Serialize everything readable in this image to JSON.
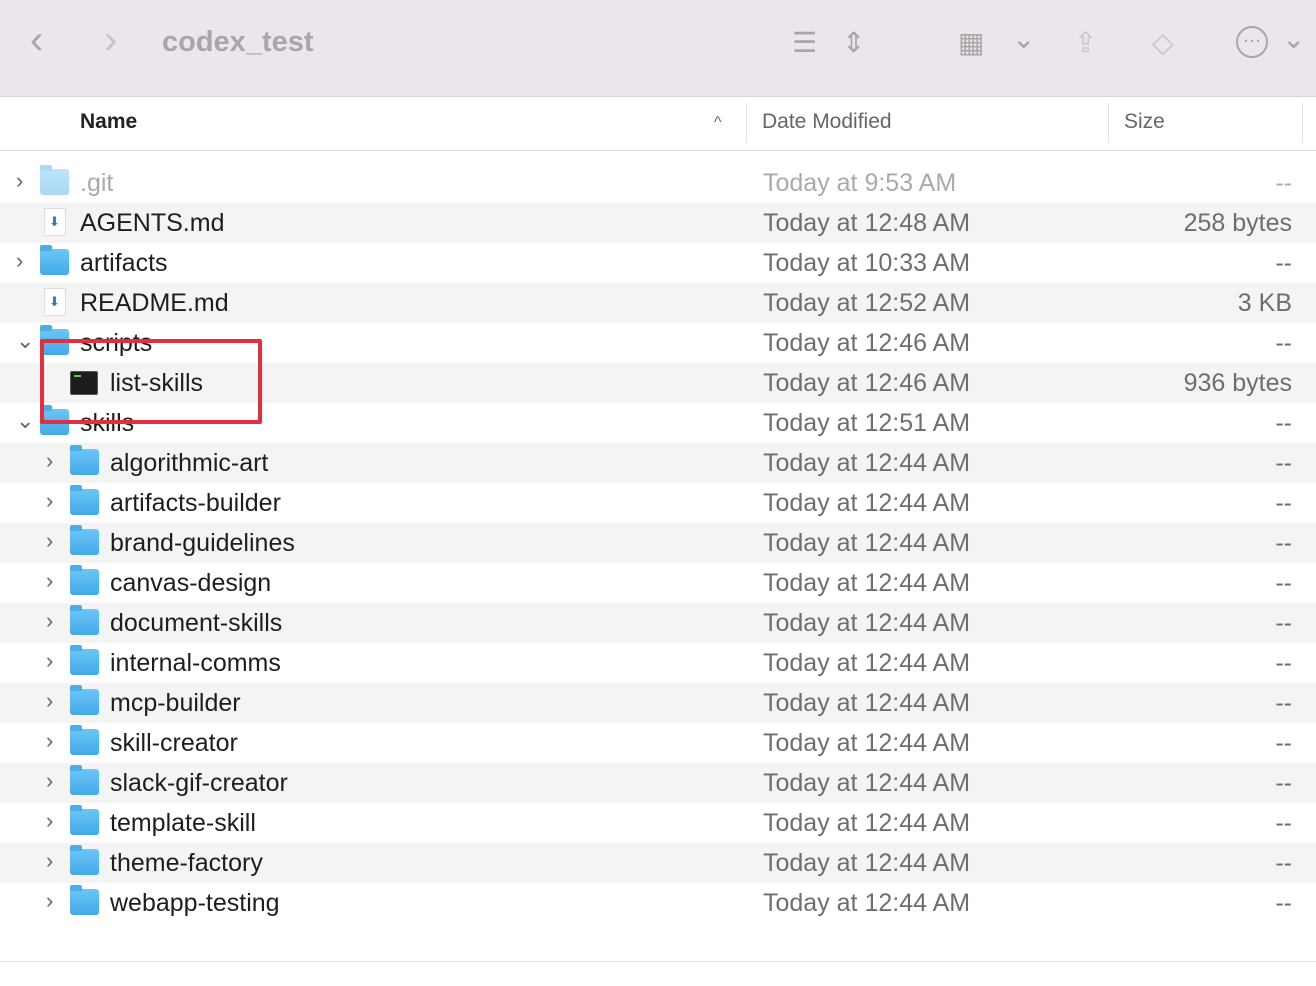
{
  "window": {
    "title": "codex_test"
  },
  "toolbar": {
    "back": "‹",
    "forward": "›",
    "view_list": "☰",
    "sort": "⇕",
    "group": "▦",
    "chev": "⌄",
    "share": "⇪",
    "tag": "◇",
    "more": "⋯"
  },
  "columns": {
    "name": "Name",
    "date": "Date Modified",
    "size": "Size",
    "sort_indicator": "^"
  },
  "rows": [
    {
      "name": ".git",
      "date": "Today at 9:53 AM",
      "size": "--",
      "type": "folder",
      "level": 0,
      "expand": "collapsed",
      "dim": true
    },
    {
      "name": "AGENTS.md",
      "date": "Today at 12:48 AM",
      "size": "258 bytes",
      "type": "doc",
      "level": 0,
      "expand": "none"
    },
    {
      "name": "artifacts",
      "date": "Today at 10:33 AM",
      "size": "--",
      "type": "folder",
      "level": 0,
      "expand": "collapsed"
    },
    {
      "name": "README.md",
      "date": "Today at 12:52 AM",
      "size": "3 KB",
      "type": "doc",
      "level": 0,
      "expand": "none"
    },
    {
      "name": "scripts",
      "date": "Today at 12:46 AM",
      "size": "--",
      "type": "folder",
      "level": 0,
      "expand": "expanded"
    },
    {
      "name": "list-skills",
      "date": "Today at 12:46 AM",
      "size": "936 bytes",
      "type": "term",
      "level": 1,
      "expand": "none"
    },
    {
      "name": "skills",
      "date": "Today at 12:51 AM",
      "size": "--",
      "type": "folder",
      "level": 0,
      "expand": "expanded"
    },
    {
      "name": "algorithmic-art",
      "date": "Today at 12:44 AM",
      "size": "--",
      "type": "folder",
      "level": 1,
      "expand": "collapsed"
    },
    {
      "name": "artifacts-builder",
      "date": "Today at 12:44 AM",
      "size": "--",
      "type": "folder",
      "level": 1,
      "expand": "collapsed"
    },
    {
      "name": "brand-guidelines",
      "date": "Today at 12:44 AM",
      "size": "--",
      "type": "folder",
      "level": 1,
      "expand": "collapsed"
    },
    {
      "name": "canvas-design",
      "date": "Today at 12:44 AM",
      "size": "--",
      "type": "folder",
      "level": 1,
      "expand": "collapsed"
    },
    {
      "name": "document-skills",
      "date": "Today at 12:44 AM",
      "size": "--",
      "type": "folder",
      "level": 1,
      "expand": "collapsed"
    },
    {
      "name": "internal-comms",
      "date": "Today at 12:44 AM",
      "size": "--",
      "type": "folder",
      "level": 1,
      "expand": "collapsed"
    },
    {
      "name": "mcp-builder",
      "date": "Today at 12:44 AM",
      "size": "--",
      "type": "folder",
      "level": 1,
      "expand": "collapsed"
    },
    {
      "name": "skill-creator",
      "date": "Today at 12:44 AM",
      "size": "--",
      "type": "folder",
      "level": 1,
      "expand": "collapsed"
    },
    {
      "name": "slack-gif-creator",
      "date": "Today at 12:44 AM",
      "size": "--",
      "type": "folder",
      "level": 1,
      "expand": "collapsed"
    },
    {
      "name": "template-skill",
      "date": "Today at 12:44 AM",
      "size": "--",
      "type": "folder",
      "level": 1,
      "expand": "collapsed"
    },
    {
      "name": "theme-factory",
      "date": "Today at 12:44 AM",
      "size": "--",
      "type": "folder",
      "level": 1,
      "expand": "collapsed"
    },
    {
      "name": "webapp-testing",
      "date": "Today at 12:44 AM",
      "size": "--",
      "type": "folder",
      "level": 1,
      "expand": "collapsed"
    }
  ],
  "colors": {
    "highlight": "#e0303f",
    "folder": "#4aaeec"
  }
}
